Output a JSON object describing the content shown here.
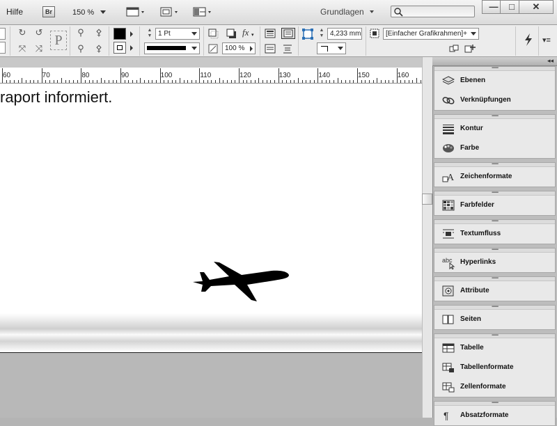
{
  "menubar": {
    "hilfe": "Hilfe",
    "bridge": "Br",
    "zoom": "150 %",
    "workspace": "Grundlagen"
  },
  "window": {
    "minimize": "—",
    "maximize": "□",
    "close": "✕"
  },
  "control": {
    "stroke_weight": "1 Pt",
    "opacity": "100 %",
    "offset": "4,233 mm",
    "object_style": "[Einfacher Grafikrahmen]+"
  },
  "ruler": {
    "labels": [
      "60",
      "70",
      "80",
      "90",
      "100",
      "110",
      "120",
      "130",
      "140",
      "150",
      "160"
    ]
  },
  "document": {
    "text": "raport informiert."
  },
  "panels": [
    {
      "items": [
        {
          "label": "Ebenen",
          "icon": "layers-icon"
        },
        {
          "label": "Verknüpfungen",
          "icon": "links-icon"
        }
      ]
    },
    {
      "items": [
        {
          "label": "Kontur",
          "icon": "stroke-icon"
        },
        {
          "label": "Farbe",
          "icon": "color-palette-icon"
        }
      ]
    },
    {
      "items": [
        {
          "label": "Zeichenformate",
          "icon": "character-styles-icon"
        }
      ]
    },
    {
      "items": [
        {
          "label": "Farbfelder",
          "icon": "swatches-icon"
        }
      ]
    },
    {
      "items": [
        {
          "label": "Textumfluss",
          "icon": "text-wrap-icon"
        }
      ]
    },
    {
      "items": [
        {
          "label": "Hyperlinks",
          "icon": "hyperlinks-icon"
        }
      ]
    },
    {
      "items": [
        {
          "label": "Attribute",
          "icon": "attributes-icon"
        }
      ]
    },
    {
      "items": [
        {
          "label": "Seiten",
          "icon": "pages-icon"
        }
      ]
    },
    {
      "items": [
        {
          "label": "Tabelle",
          "icon": "table-icon"
        },
        {
          "label": "Tabellenformate",
          "icon": "table-styles-icon"
        },
        {
          "label": "Zellenformate",
          "icon": "cell-styles-icon"
        }
      ]
    },
    {
      "items": [
        {
          "label": "Absatzformate",
          "icon": "paragraph-styles-icon"
        }
      ]
    }
  ]
}
